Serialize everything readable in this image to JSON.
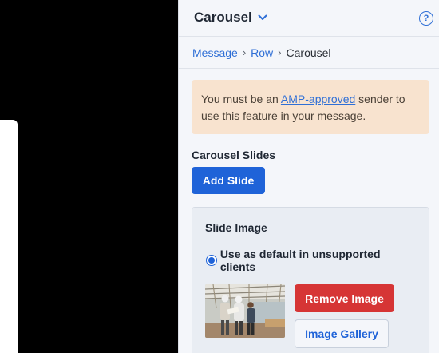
{
  "panel": {
    "title": "Carousel",
    "help_icon": "?"
  },
  "breadcrumb": {
    "items": [
      "Message",
      "Row",
      "Carousel"
    ],
    "separator": "›"
  },
  "notice": {
    "prefix": "You must be an ",
    "link": "AMP-approved",
    "suffix": " sender to use this feature in your message."
  },
  "slides": {
    "label": "Carousel Slides",
    "add_button": "Add Slide"
  },
  "slide_image": {
    "title": "Slide Image",
    "radio_label": "Use as default in unsupported clients",
    "radio_checked": true,
    "remove_button": "Remove Image",
    "gallery_button": "Image Gallery"
  },
  "colors": {
    "accent": "#1f63d8",
    "danger": "#d63535",
    "notice_bg": "#f8e3cf"
  }
}
